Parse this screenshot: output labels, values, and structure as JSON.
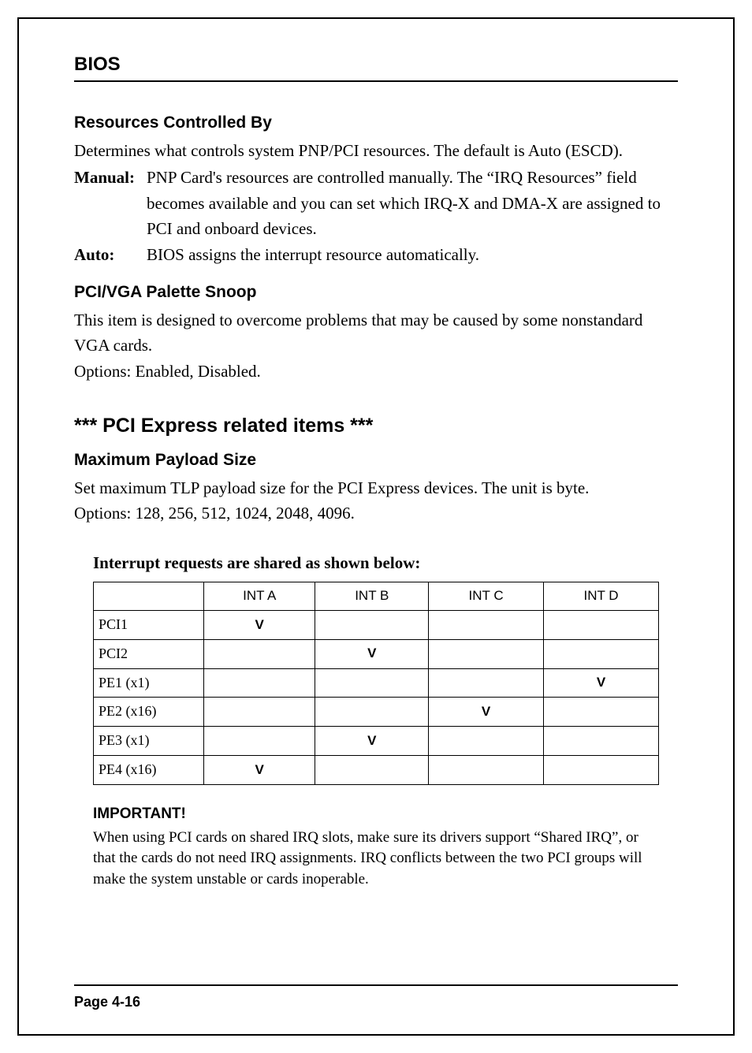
{
  "header": {
    "title": "BIOS"
  },
  "sections": {
    "rcb": {
      "heading": "Resources Controlled By",
      "intro": "Determines what controls system PNP/PCI resources. The default is Auto (ESCD).",
      "manual_term": "Manual",
      "manual_desc": "PNP Card's resources are controlled manually. The “IRQ Resources” field becomes available and you can set which IRQ-X and DMA-X are assigned to PCI and onboard devices.",
      "auto_term": "Auto",
      "auto_desc": "BIOS assigns the interrupt resource automatically."
    },
    "pvs": {
      "heading": "PCI/VGA Palette Snoop",
      "body1": "This item is designed to overcome problems that may be caused by some nonstandard VGA cards.",
      "body2": "Options: Enabled, Disabled."
    },
    "pci_express_h": "*** PCI Express related items ***",
    "mps": {
      "heading": "Maximum Payload Size",
      "body1": "Set maximum TLP payload size for the PCI Express devices.  The unit is byte.",
      "body2": "Options: 128, 256, 512, 1024, 2048, 4096."
    },
    "irq_caption": "Interrupt requests are shared as shown below:",
    "note": {
      "heading": "IMPORTANT!",
      "body": "When using PCI cards on shared IRQ slots, make sure its drivers support “Shared IRQ”, or that the cards do not need IRQ assignments. IRQ conflicts between the two PCI groups will make the system unstable or cards inoperable."
    }
  },
  "footer": {
    "page_label": "Page 4-16"
  },
  "chart_data": {
    "type": "table",
    "title": "Interrupt requests are shared as shown below:",
    "columns": [
      "INT A",
      "INT B",
      "INT C",
      "INT D"
    ],
    "rows": [
      "PCI1",
      "PCI2",
      "PE1 (x1)",
      "PE2 (x16)",
      "PE3 (x1)",
      "PE4 (x16)"
    ],
    "mark": "V",
    "cells": [
      [
        "V",
        "",
        "",
        ""
      ],
      [
        "",
        "V",
        "",
        ""
      ],
      [
        "",
        "",
        "",
        "V"
      ],
      [
        "",
        "",
        "V",
        ""
      ],
      [
        "",
        "V",
        "",
        ""
      ],
      [
        "V",
        "",
        "",
        ""
      ]
    ]
  }
}
